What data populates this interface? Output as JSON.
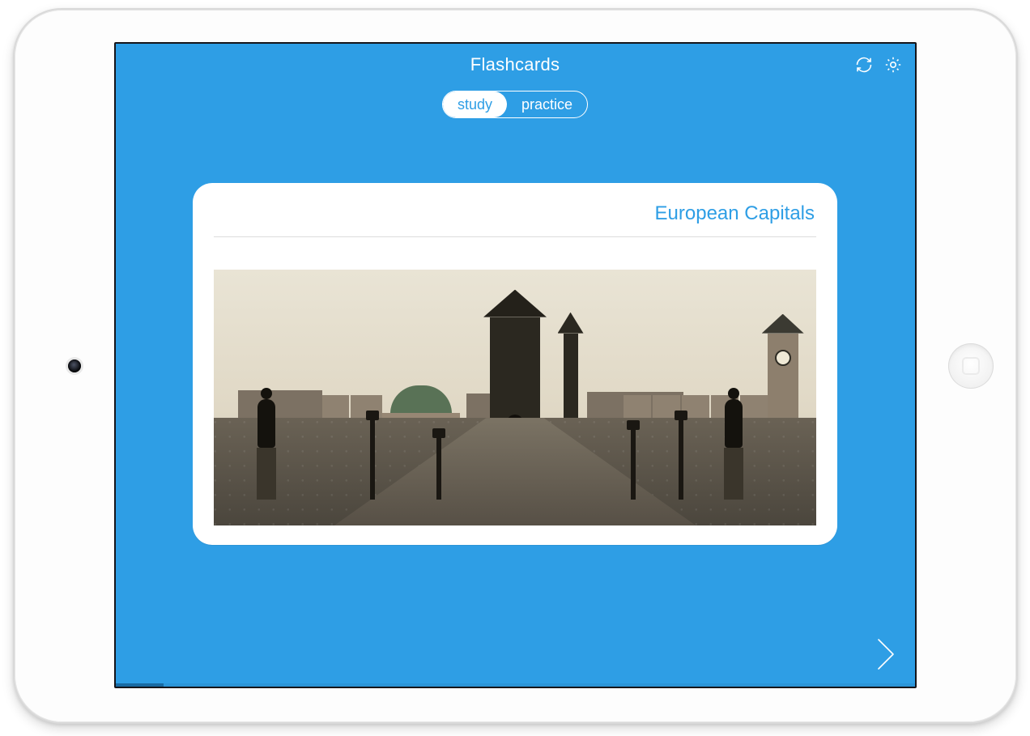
{
  "header": {
    "title": "Flashcards",
    "icons": {
      "sync": "sync-icon",
      "settings": "gear-icon"
    }
  },
  "mode_toggle": {
    "options": [
      "study",
      "practice"
    ],
    "active": "study"
  },
  "card": {
    "deck_title": "European Capitals",
    "image_alt": "Historic stone bridge with statues leading to a Gothic tower, dome and clocktower skyline"
  },
  "nav": {
    "next": "Next"
  },
  "progress_percent": 6,
  "colors": {
    "accent": "#2e9ee5"
  }
}
